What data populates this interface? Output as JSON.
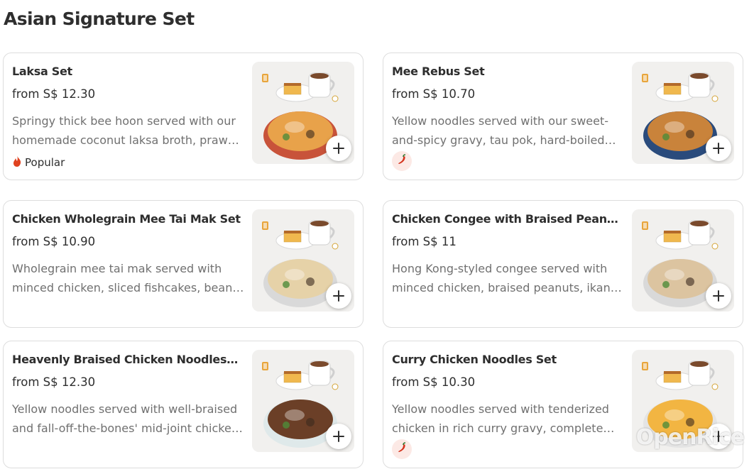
{
  "section": {
    "title": "Asian Signature Set"
  },
  "items": [
    {
      "name": "Laksa Set",
      "price": "from S$ 12.30",
      "description": "Springy thick bee hoon served with our homemade coconut laksa broth, prawns, fishcake and tau pok.",
      "badge": "Popular",
      "spicy": false
    },
    {
      "name": "Mee Rebus Set",
      "price": "from S$ 10.70",
      "description": "Yellow noodles served with our sweet-and-spicy gravy, tau pok, hard-boiled egg and lime.",
      "badge": "",
      "spicy": true
    },
    {
      "name": "Chicken Wholegrain Mee Tai Mak Set",
      "price": "from S$ 10.90",
      "description": "Wholegrain mee tai mak served with minced chicken, sliced fishcakes, bean sprouts and chilli.",
      "badge": "",
      "spicy": false
    },
    {
      "name": "Chicken Congee with Braised Peanuts Set",
      "price": "from S$ 11",
      "description": "Hong Kong-styled congee served with minced chicken, braised peanuts, ikan bilis and you tiao.",
      "badge": "",
      "spicy": false
    },
    {
      "name": "Heavenly Braised Chicken Noodles Set",
      "price": "from S$ 12.30",
      "description": "Yellow noodles served with well-braised and fall-off-the-bones' mid-joint chicken wings.",
      "badge": "",
      "spicy": false
    },
    {
      "name": "Curry Chicken Noodles Set",
      "price": "from S$ 10.30",
      "description": "Yellow noodles served with tenderized chicken in rich curry gravy, complete with potatoes.",
      "badge": "",
      "spicy": true
    }
  ],
  "colors": {
    "popular_flame": "#e0421f",
    "spicy_chilli": "#d4321c",
    "spicy_bg": "#fce9e5"
  },
  "icons": {
    "add": "plus-icon",
    "popular": "flame-icon",
    "spicy": "chilli-icon"
  },
  "watermark": "OpenRice"
}
